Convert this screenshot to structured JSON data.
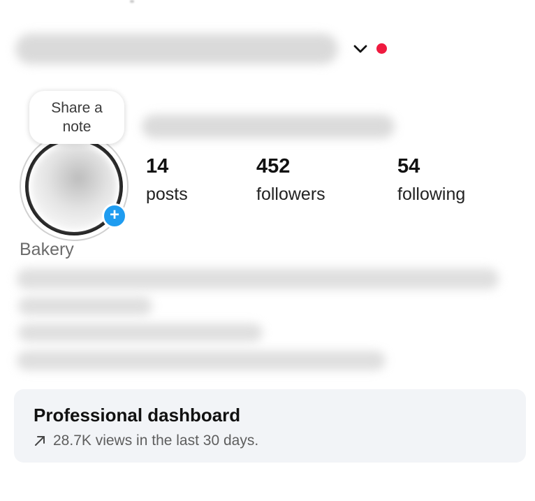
{
  "note": {
    "label": "Share a note"
  },
  "stats": [
    {
      "value": "14",
      "label": "posts"
    },
    {
      "value": "452",
      "label": "followers"
    },
    {
      "value": "54",
      "label": "following"
    }
  ],
  "category": "Bakery",
  "dashboard": {
    "title": "Professional dashboard",
    "subtitle": "28.7K views in the last 30 days."
  },
  "colors": {
    "notification_dot": "#ef1a3f",
    "add_story": "#1f9cf0",
    "card_background": "#f2f4f7"
  },
  "icons": {
    "account_switcher": "chevron-down-icon",
    "add_story": "plus-icon",
    "trend": "arrow-up-right-icon"
  }
}
